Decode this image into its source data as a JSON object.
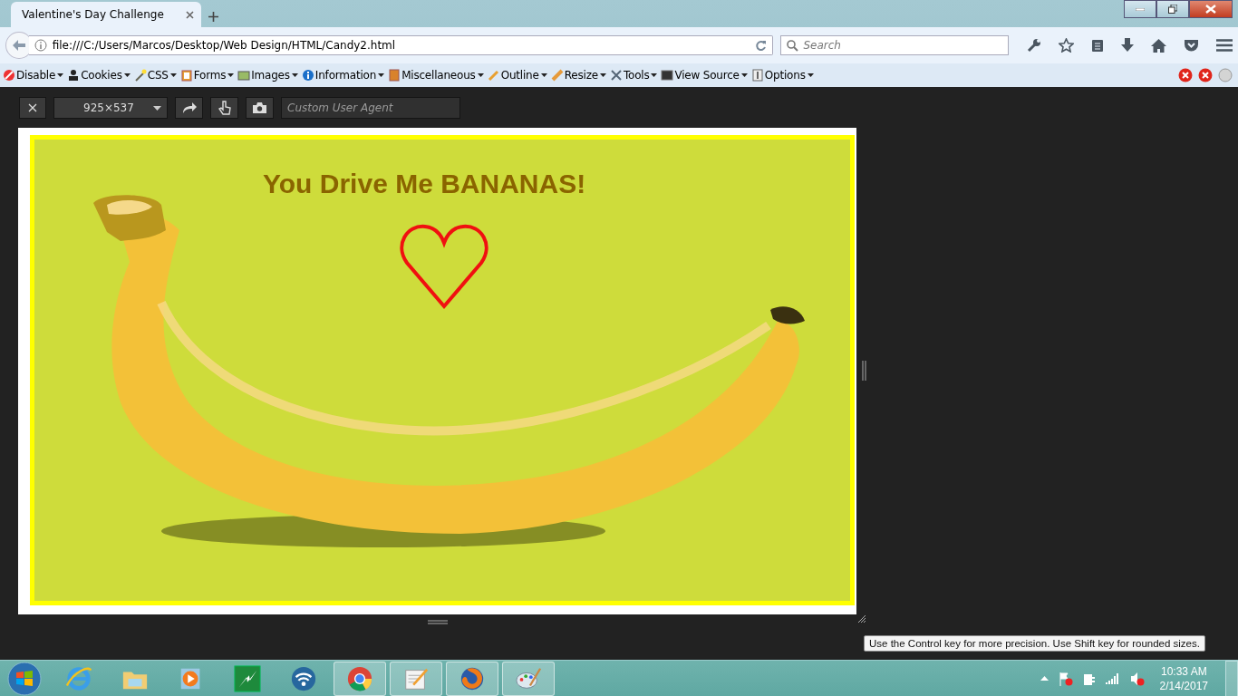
{
  "tab": {
    "title": "Valentine's Day Challenge",
    "selected": true
  },
  "address_bar": {
    "url": "file:///C:/Users/Marcos/Desktop/Web Design/HTML/Candy2.html"
  },
  "search": {
    "placeholder": "Search"
  },
  "developer_toolbar": {
    "items": [
      {
        "label": "Disable"
      },
      {
        "label": "Cookies"
      },
      {
        "label": "CSS"
      },
      {
        "label": "Forms"
      },
      {
        "label": "Images"
      },
      {
        "label": "Information"
      },
      {
        "label": "Miscellaneous"
      },
      {
        "label": "Outline"
      },
      {
        "label": "Resize"
      },
      {
        "label": "Tools"
      },
      {
        "label": "View Source"
      },
      {
        "label": "Options"
      }
    ]
  },
  "responsive_toolbar": {
    "size": "925×537",
    "user_agent": {
      "placeholder": "Custom User Agent"
    }
  },
  "page": {
    "heading": "You Drive Me BANANAS!"
  },
  "tooltip": "Use the Control key for more precision. Use Shift key for rounded sizes.",
  "taskbar": {
    "apps": [
      {
        "kind": "ie",
        "running": false
      },
      {
        "kind": "folder",
        "running": false
      },
      {
        "kind": "media",
        "running": false
      },
      {
        "kind": "bolt",
        "running": false
      },
      {
        "kind": "wifi",
        "running": false
      },
      {
        "kind": "chrome",
        "running": true
      },
      {
        "kind": "notepad",
        "running": true
      },
      {
        "kind": "firefox",
        "running": true
      },
      {
        "kind": "paint",
        "running": true
      }
    ],
    "time": "10:33 AM",
    "date": "2/14/2017"
  }
}
